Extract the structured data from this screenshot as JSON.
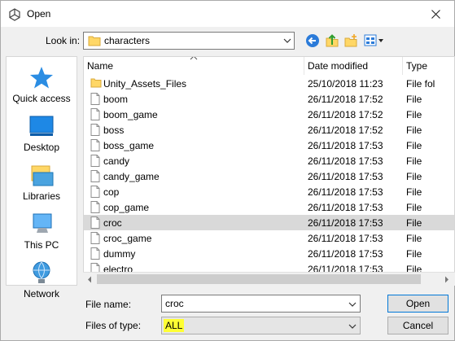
{
  "window": {
    "title": "Open"
  },
  "toolbar": {
    "look_in_label": "Look in:",
    "look_in_value": "characters",
    "icons": [
      "back-icon",
      "up-folder-icon",
      "new-folder-icon",
      "view-menu-icon"
    ]
  },
  "places": [
    {
      "label": "Quick access",
      "icon": "star-icon"
    },
    {
      "label": "Desktop",
      "icon": "desktop-icon"
    },
    {
      "label": "Libraries",
      "icon": "libraries-icon"
    },
    {
      "label": "This PC",
      "icon": "computer-icon"
    },
    {
      "label": "Network",
      "icon": "network-icon"
    }
  ],
  "columns": {
    "name": "Name",
    "date": "Date modified",
    "type": "Type"
  },
  "files": [
    {
      "name": "Unity_Assets_Files",
      "date": "25/10/2018 11:23",
      "type": "File fol",
      "kind": "folder"
    },
    {
      "name": "boom",
      "date": "26/11/2018 17:52",
      "type": "File",
      "kind": "file"
    },
    {
      "name": "boom_game",
      "date": "26/11/2018 17:52",
      "type": "File",
      "kind": "file"
    },
    {
      "name": "boss",
      "date": "26/11/2018 17:52",
      "type": "File",
      "kind": "file"
    },
    {
      "name": "boss_game",
      "date": "26/11/2018 17:53",
      "type": "File",
      "kind": "file"
    },
    {
      "name": "candy",
      "date": "26/11/2018 17:53",
      "type": "File",
      "kind": "file"
    },
    {
      "name": "candy_game",
      "date": "26/11/2018 17:53",
      "type": "File",
      "kind": "file"
    },
    {
      "name": "cop",
      "date": "26/11/2018 17:53",
      "type": "File",
      "kind": "file"
    },
    {
      "name": "cop_game",
      "date": "26/11/2018 17:53",
      "type": "File",
      "kind": "file"
    },
    {
      "name": "croc",
      "date": "26/11/2018 17:53",
      "type": "File",
      "kind": "file",
      "selected": true
    },
    {
      "name": "croc_game",
      "date": "26/11/2018 17:53",
      "type": "File",
      "kind": "file"
    },
    {
      "name": "dummy",
      "date": "26/11/2018 17:53",
      "type": "File",
      "kind": "file"
    },
    {
      "name": "electro",
      "date": "26/11/2018 17:53",
      "type": "File",
      "kind": "file"
    }
  ],
  "filename": {
    "label": "File name:",
    "value": "croc"
  },
  "filetype": {
    "label": "Files of type:",
    "value": "ALL"
  },
  "buttons": {
    "open": "Open",
    "cancel": "Cancel"
  },
  "colors": {
    "selection": "#d9d9d9",
    "highlight": "#ffff33",
    "accent": "#0078d7",
    "folder": "#ffd766"
  }
}
